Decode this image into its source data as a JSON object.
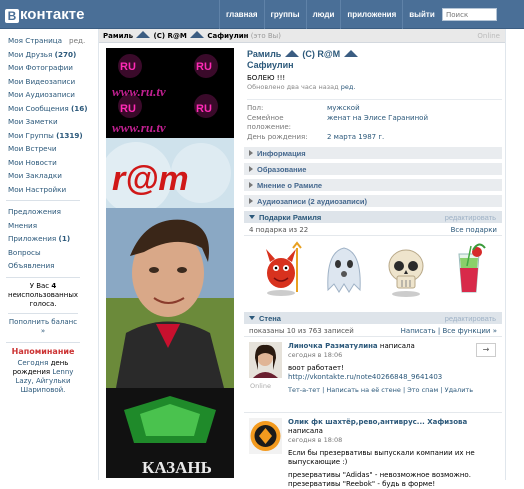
{
  "header": {
    "logo_letter": "В",
    "logo_text": "контакте",
    "nav": [
      "главная",
      "группы",
      "люди",
      "приложения",
      "выйти"
    ],
    "search_placeholder": "Поиск"
  },
  "sidebar": {
    "items": [
      {
        "label": "Моя Страница",
        "extra": "ред."
      },
      {
        "label": "Мои Друзья",
        "count": "(270)"
      },
      {
        "label": "Мои Фотографии"
      },
      {
        "label": "Мои Видеозаписи"
      },
      {
        "label": "Мои Аудиозаписи"
      },
      {
        "label": "Мои Сообщения",
        "count": "(16)"
      },
      {
        "label": "Мои Заметки"
      },
      {
        "label": "Мои Группы",
        "count": "(1319)"
      },
      {
        "label": "Мои Встречи"
      },
      {
        "label": "Мои Новости"
      },
      {
        "label": "Мои Закладки"
      },
      {
        "label": "Мои Настройки"
      }
    ],
    "items2": [
      {
        "label": "Предложения"
      },
      {
        "label": "Мнения"
      },
      {
        "label": "Приложения",
        "count": "(1)"
      },
      {
        "label": "Вопросы"
      },
      {
        "label": "Объявления"
      }
    ],
    "votes_pre": "У Вас",
    "votes_count": "4",
    "votes_post": "неиспользованных голоса.",
    "pay_label": "Пополнить баланс »",
    "reminder_title": "Напоминание",
    "reminder_today": "Сегодня",
    "reminder_text": "день рождения",
    "reminder_people": "Lenny Lazy, Айгульки Шариповой."
  },
  "profile": {
    "crumb_name1": "Рамиль",
    "crumb_mid": "(C) R@M",
    "crumb_name2": "Сафиулин",
    "crumb_self": "(это Вы)",
    "online": "Online",
    "name_line1_a": "Рамиль",
    "name_line1_b": "(C) R@M",
    "name_line2": "Сафиулин",
    "status": "БОЛЕЮ !!!",
    "updated": "Обновлено два часа назад",
    "updated_link": "ред.",
    "info": [
      {
        "k": "Пол:",
        "v": "мужской"
      },
      {
        "k": "Семейное положение:",
        "v": "женат на",
        "v2": "Элисе Гараниной"
      },
      {
        "k": "День рождения:",
        "v": "2 марта 1987 г."
      }
    ]
  },
  "sections": [
    "Информация",
    "Образование",
    "Мнение о Рамиле",
    "Аудиозаписи (2 аудиозаписи)"
  ],
  "gifts": {
    "title": "Подарки Рамиля",
    "edit": "редактировать",
    "count_text": "4 подарка из 22",
    "all_link": "Все подарки"
  },
  "wall": {
    "title": "Стена",
    "edit": "редактировать",
    "count_text": "показаны 10 из 763 записей",
    "write_link": "Написать",
    "all_link": "Все функции »",
    "posts": [
      {
        "author": "Линочка Разматулина",
        "wrote": "написала",
        "time": "сегодня в 18:06",
        "text": "воот работает!",
        "link": "http://vkontakte.ru/note40266848_9641403",
        "actions": "Тет-а-тет  |  Написать на её стене  |  Это спам  |  Удалить",
        "online": "Online"
      },
      {
        "author": "Олик фк шахтёр,рево,антиврус... Хафизова",
        "wrote": "написала",
        "time": "сегодня в 18:08",
        "text1": "Если бы презервативы выпускали компании их не выпускающие :)",
        "text2": "презервативы \"Adidas\" - невозможное возможно.",
        "text3": "презервативы \"Reebok\" - будь в форме!"
      }
    ]
  },
  "photo_texts": {
    "top_logo": "RU",
    "site": "www.ru.tv",
    "ram": "r@m",
    "city": "КАЗАНЬ"
  },
  "colors": {
    "topbar": "#4a6f97",
    "link": "#2b587a",
    "section_bg": "#e9ecef"
  }
}
